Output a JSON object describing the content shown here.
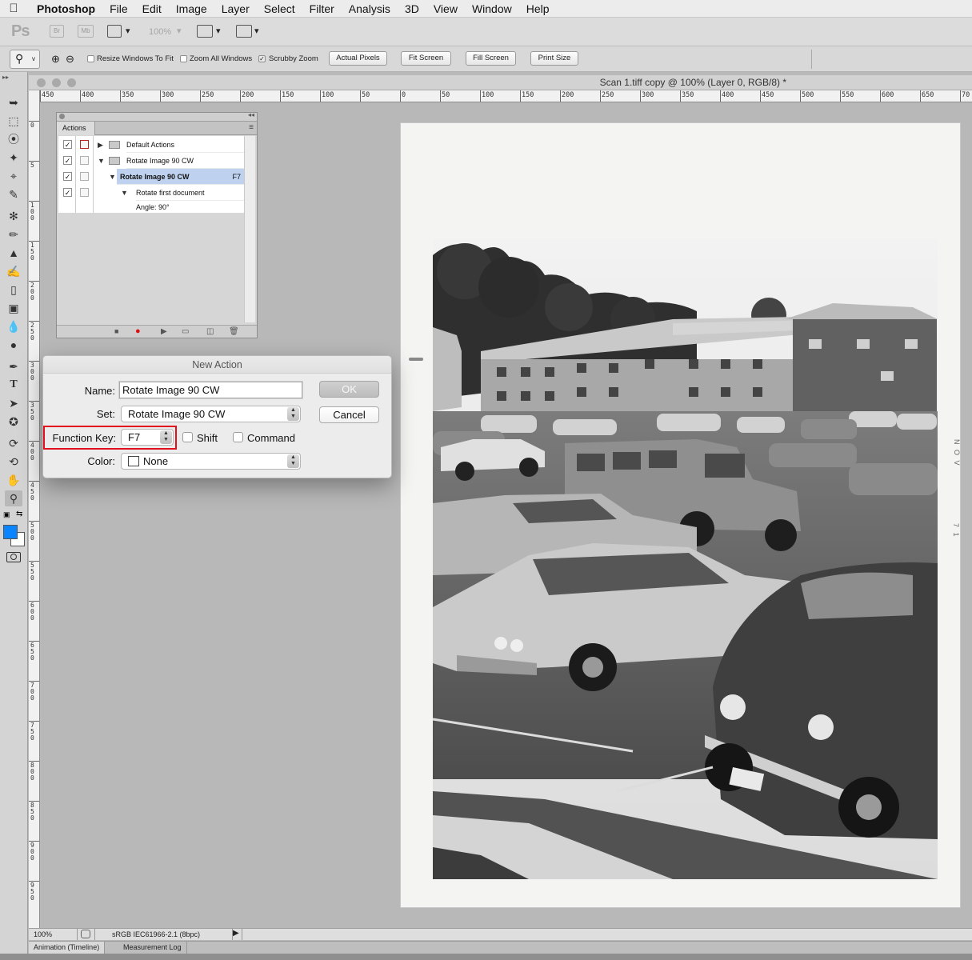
{
  "menubar": {
    "apple": "",
    "items": [
      "Photoshop",
      "File",
      "Edit",
      "Image",
      "Layer",
      "Select",
      "Filter",
      "Analysis",
      "3D",
      "View",
      "Window",
      "Help"
    ]
  },
  "appbar": {
    "logo": "Ps",
    "bridge": "Br",
    "mini_bridge": "Mb",
    "zoom": "100%"
  },
  "options": {
    "resize_windows": "Resize Windows To Fit",
    "zoom_all": "Zoom All Windows",
    "scrubby": "Scrubby Zoom",
    "scrubby_checked": true,
    "actual_pixels": "Actual Pixels",
    "fit_screen": "Fit Screen",
    "fill_screen": "Fill Screen",
    "print_size": "Print Size"
  },
  "document": {
    "title": "Scan 1.tiff copy @ 100% (Layer 0, RGB/8) *",
    "h_ruler": [
      "450",
      "400",
      "350",
      "300",
      "250",
      "200",
      "150",
      "100",
      "50",
      "0",
      "50",
      "100",
      "150",
      "200",
      "250",
      "300",
      "350",
      "400",
      "450",
      "500",
      "550",
      "600",
      "650",
      "70"
    ],
    "v_ruler": [
      "0",
      "5",
      "1 0 0",
      "1 5 0",
      "2 0 0",
      "2 5 0",
      "3 0 0",
      "3 5 0",
      "4 0 0",
      "4 5 0",
      "5 0 0",
      "5 5 0",
      "6 0 0",
      "6 5 0",
      "7 0 0",
      "7 5 0",
      "8 0 0",
      "8 5 0",
      "9 0 0",
      "9 5 0"
    ],
    "photo_annotations": [
      "N O V",
      "7 1"
    ]
  },
  "actions_panel": {
    "tab": "Actions",
    "rows": [
      {
        "label": "Default Actions",
        "checked": true,
        "dialog_red": true,
        "triangle": "▶",
        "folder": true
      },
      {
        "label": "Rotate Image 90 CW",
        "checked": true,
        "dialog_red": false,
        "triangle": "▼",
        "folder": true
      },
      {
        "label": "Rotate Image 90 CW",
        "shortcut": "F7",
        "checked": true,
        "selected": true,
        "triangle": "▼"
      },
      {
        "label": "Rotate first document",
        "checked": true,
        "triangle": "▼"
      },
      {
        "label": "Angle: 90°"
      }
    ]
  },
  "dialog": {
    "title": "New Action",
    "name_label": "Name:",
    "name_value": "Rotate Image 90 CW",
    "set_label": "Set:",
    "set_value": "Rotate Image 90 CW",
    "fkey_label": "Function Key:",
    "fkey_value": "F7",
    "shift_label": "Shift",
    "command_label": "Command",
    "color_label": "Color:",
    "color_value": "None",
    "ok": "OK",
    "cancel": "Cancel"
  },
  "status": {
    "zoom": "100%",
    "profile": "sRGB IEC61966-2.1 (8bpc)"
  },
  "bottom_tabs": [
    "Animation (Timeline)",
    "Measurement Log"
  ],
  "colors": {
    "foreground": "#0a84ff",
    "background": "#ffffff",
    "highlight": "#e0101f"
  }
}
